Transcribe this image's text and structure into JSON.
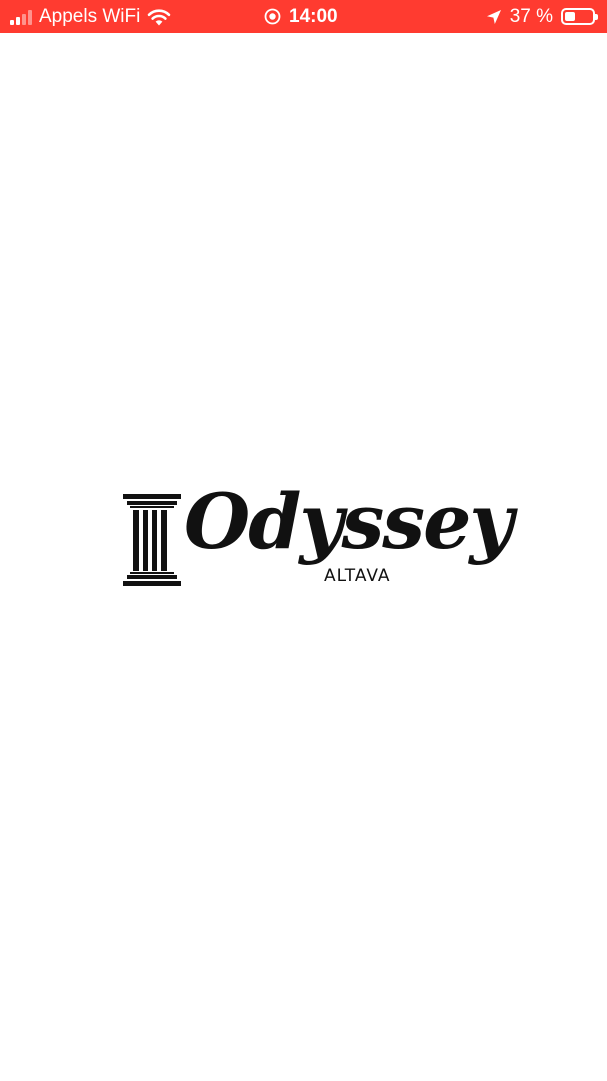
{
  "status_bar": {
    "background": "#ff3b30",
    "carrier": "Appels WiFi",
    "time": "14:00",
    "battery_text": "37 %",
    "battery_level": 0.37,
    "icons": [
      "signal-icon",
      "wifi-icon",
      "screen-record-icon",
      "location-arrow-icon",
      "battery-icon"
    ]
  },
  "logo": {
    "wordmark": "Odyssey",
    "subtitle": "ALTAVA",
    "icon": "pillar-icon",
    "color": "#111111"
  }
}
